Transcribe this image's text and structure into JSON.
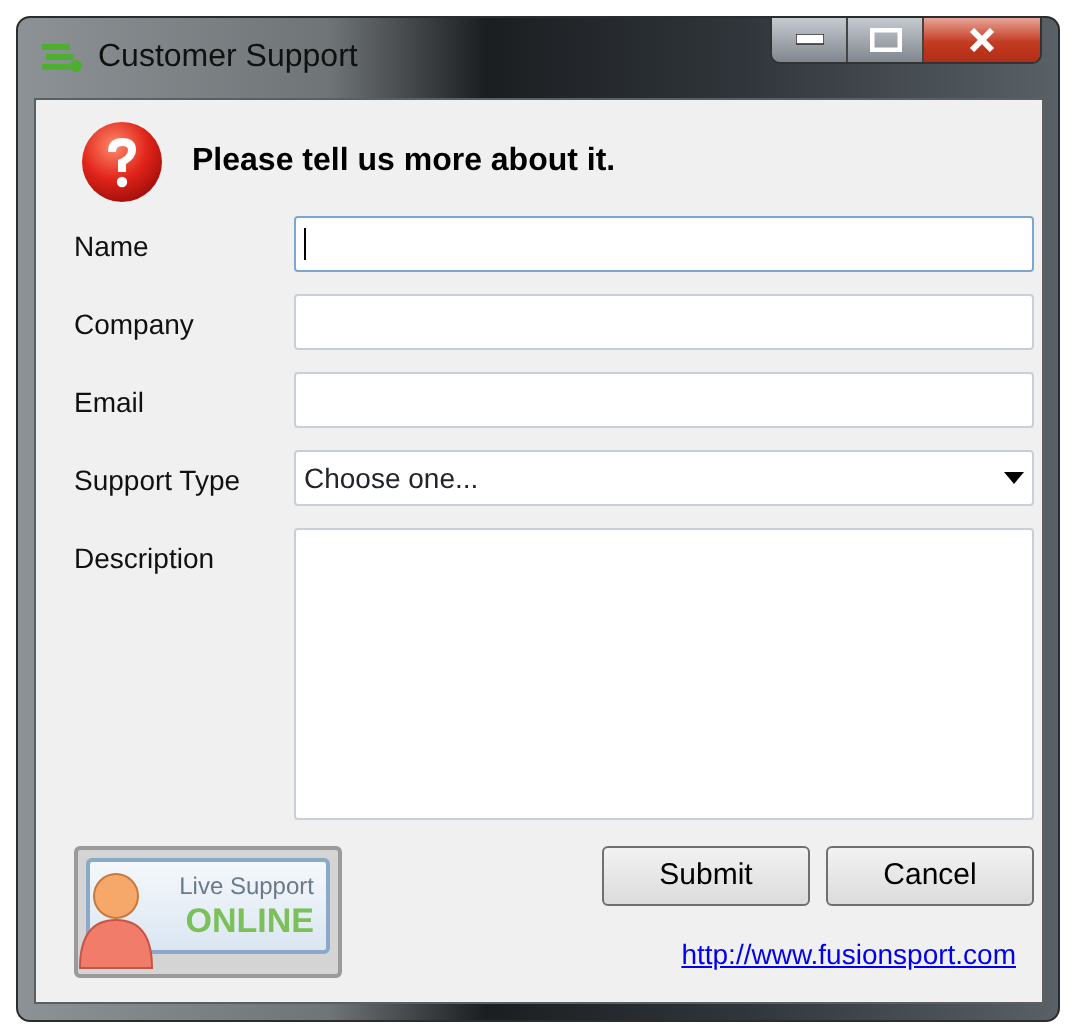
{
  "window": {
    "title": "Customer Support"
  },
  "heading": "Please tell us more about it.",
  "fields": [
    {
      "label": "Name",
      "kind": "text",
      "focused": true
    },
    {
      "label": "Company",
      "kind": "text",
      "focused": false
    },
    {
      "label": "Email",
      "kind": "text",
      "focused": false
    },
    {
      "label": "Support Type",
      "kind": "select",
      "value": "Choose one...",
      "focused": false
    },
    {
      "label": "Description",
      "kind": "textarea",
      "focused": false
    }
  ],
  "live_support": {
    "line_1": "Live Support",
    "line_2": "ONLINE"
  },
  "buttons": [
    "Submit",
    "Cancel"
  ],
  "link": "http://www.fusionsport.com"
}
